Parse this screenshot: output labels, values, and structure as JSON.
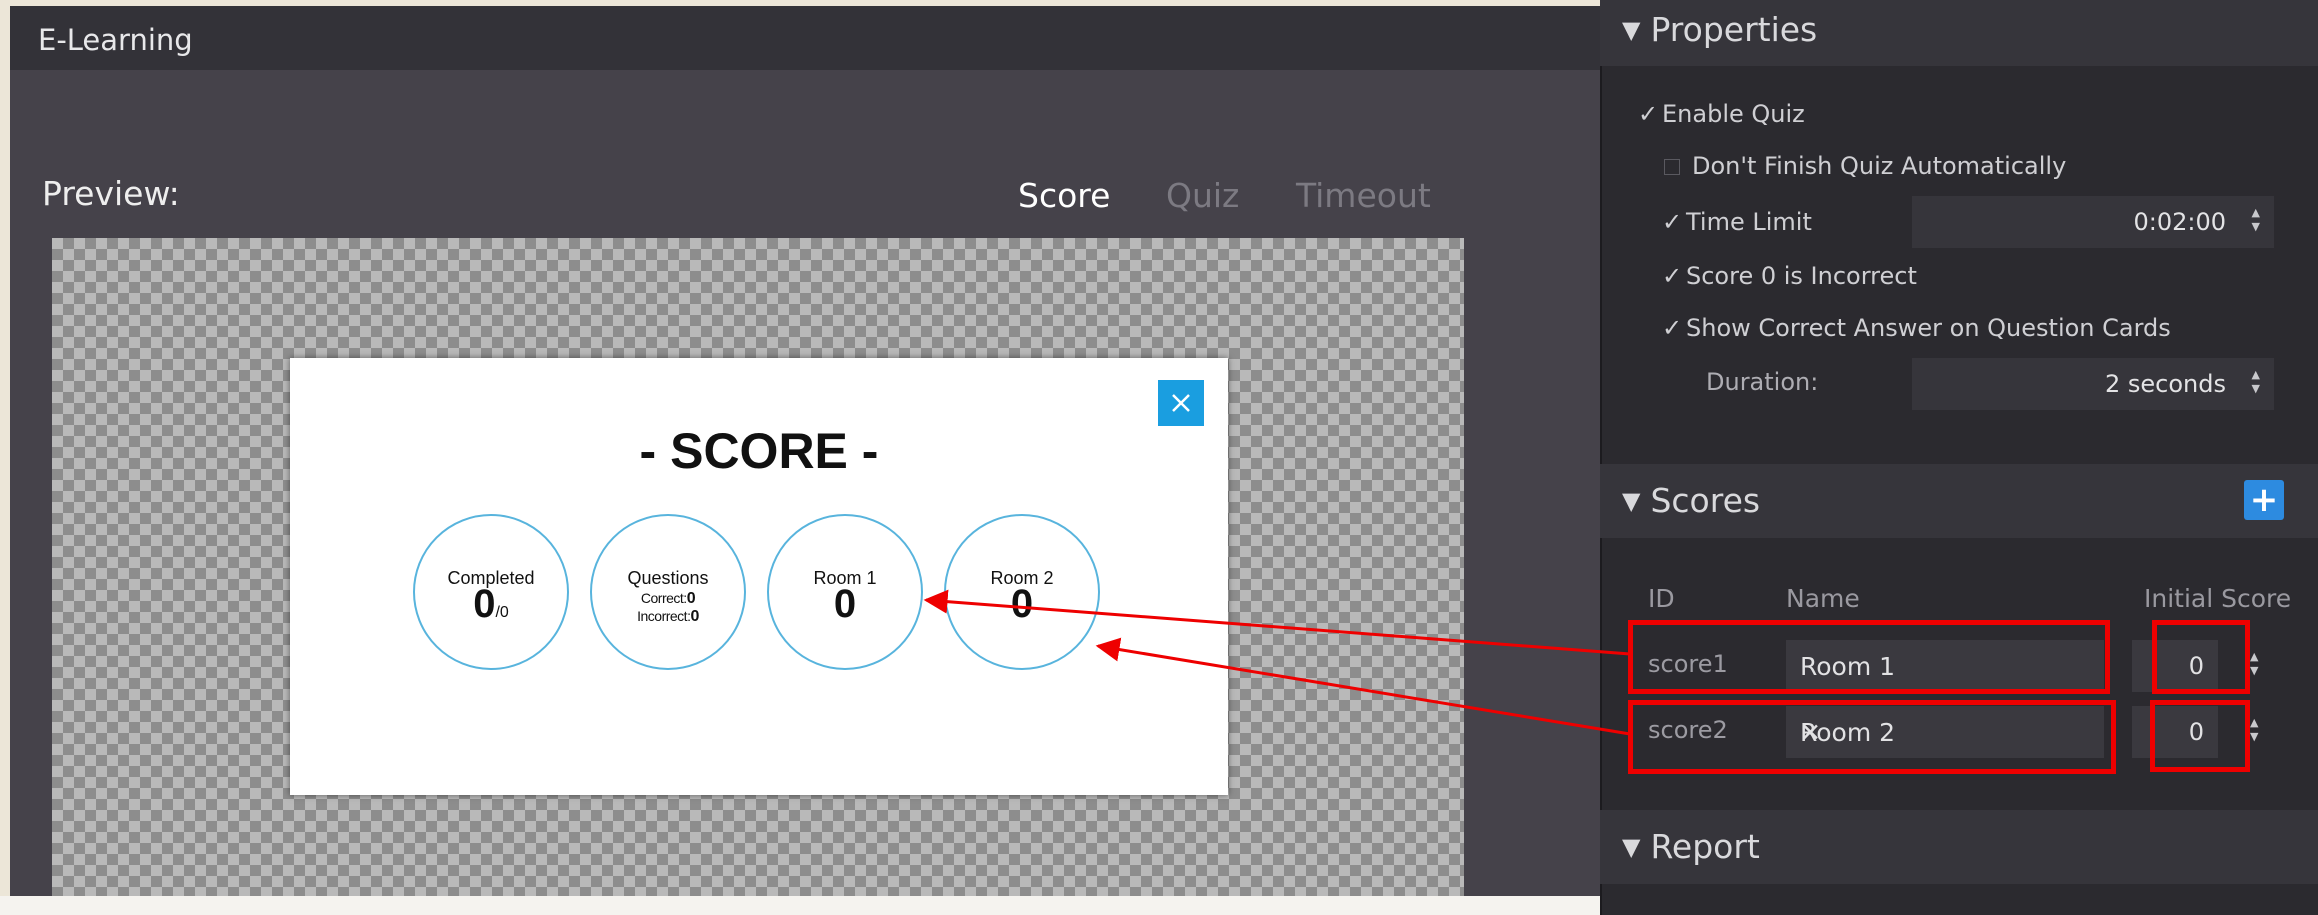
{
  "app": {
    "title": "E-Learning"
  },
  "preview": {
    "label": "Preview:",
    "tabs": [
      {
        "label": "Score",
        "active": true
      },
      {
        "label": "Quiz",
        "active": false
      },
      {
        "label": "Timeout",
        "active": false
      }
    ]
  },
  "score_card": {
    "title": "- SCORE -",
    "circles": {
      "completed": {
        "label": "Completed",
        "value": "0",
        "total": "/0"
      },
      "questions": {
        "label": "Questions",
        "correct_label": "Correct:",
        "correct_value": "0",
        "incorrect_label": "Incorrect:",
        "incorrect_value": "0"
      },
      "room1": {
        "label": "Room 1",
        "value": "0"
      },
      "room2": {
        "label": "Room 2",
        "value": "0"
      }
    }
  },
  "properties": {
    "title": "Properties",
    "enable_quiz": "Enable Quiz",
    "dont_finish": "Don't Finish Quiz Automatically",
    "time_limit": "Time Limit",
    "time_limit_value": "0:02:00",
    "score0_incorrect": "Score 0 is Incorrect",
    "show_correct": "Show Correct Answer on Question Cards",
    "duration_label": "Duration:",
    "duration_value": "2 seconds"
  },
  "scores": {
    "title": "Scores",
    "col_id": "ID",
    "col_name": "Name",
    "col_initial": "Initial Score",
    "rows": [
      {
        "id": "score1",
        "name": "Room 1",
        "initial": "0"
      },
      {
        "id": "score2",
        "name": "Room 2",
        "initial": "0"
      }
    ]
  },
  "report": {
    "title": "Report"
  },
  "colors": {
    "accent_blue": "#1a9ee0",
    "annotation_red": "#ee0000",
    "panel_dark": "#2b2a2f"
  },
  "icons": {
    "close": "close-icon",
    "add": "plus-icon",
    "remove": "x-icon",
    "collapse": "triangle-down-icon",
    "check": "checkmark-icon"
  }
}
